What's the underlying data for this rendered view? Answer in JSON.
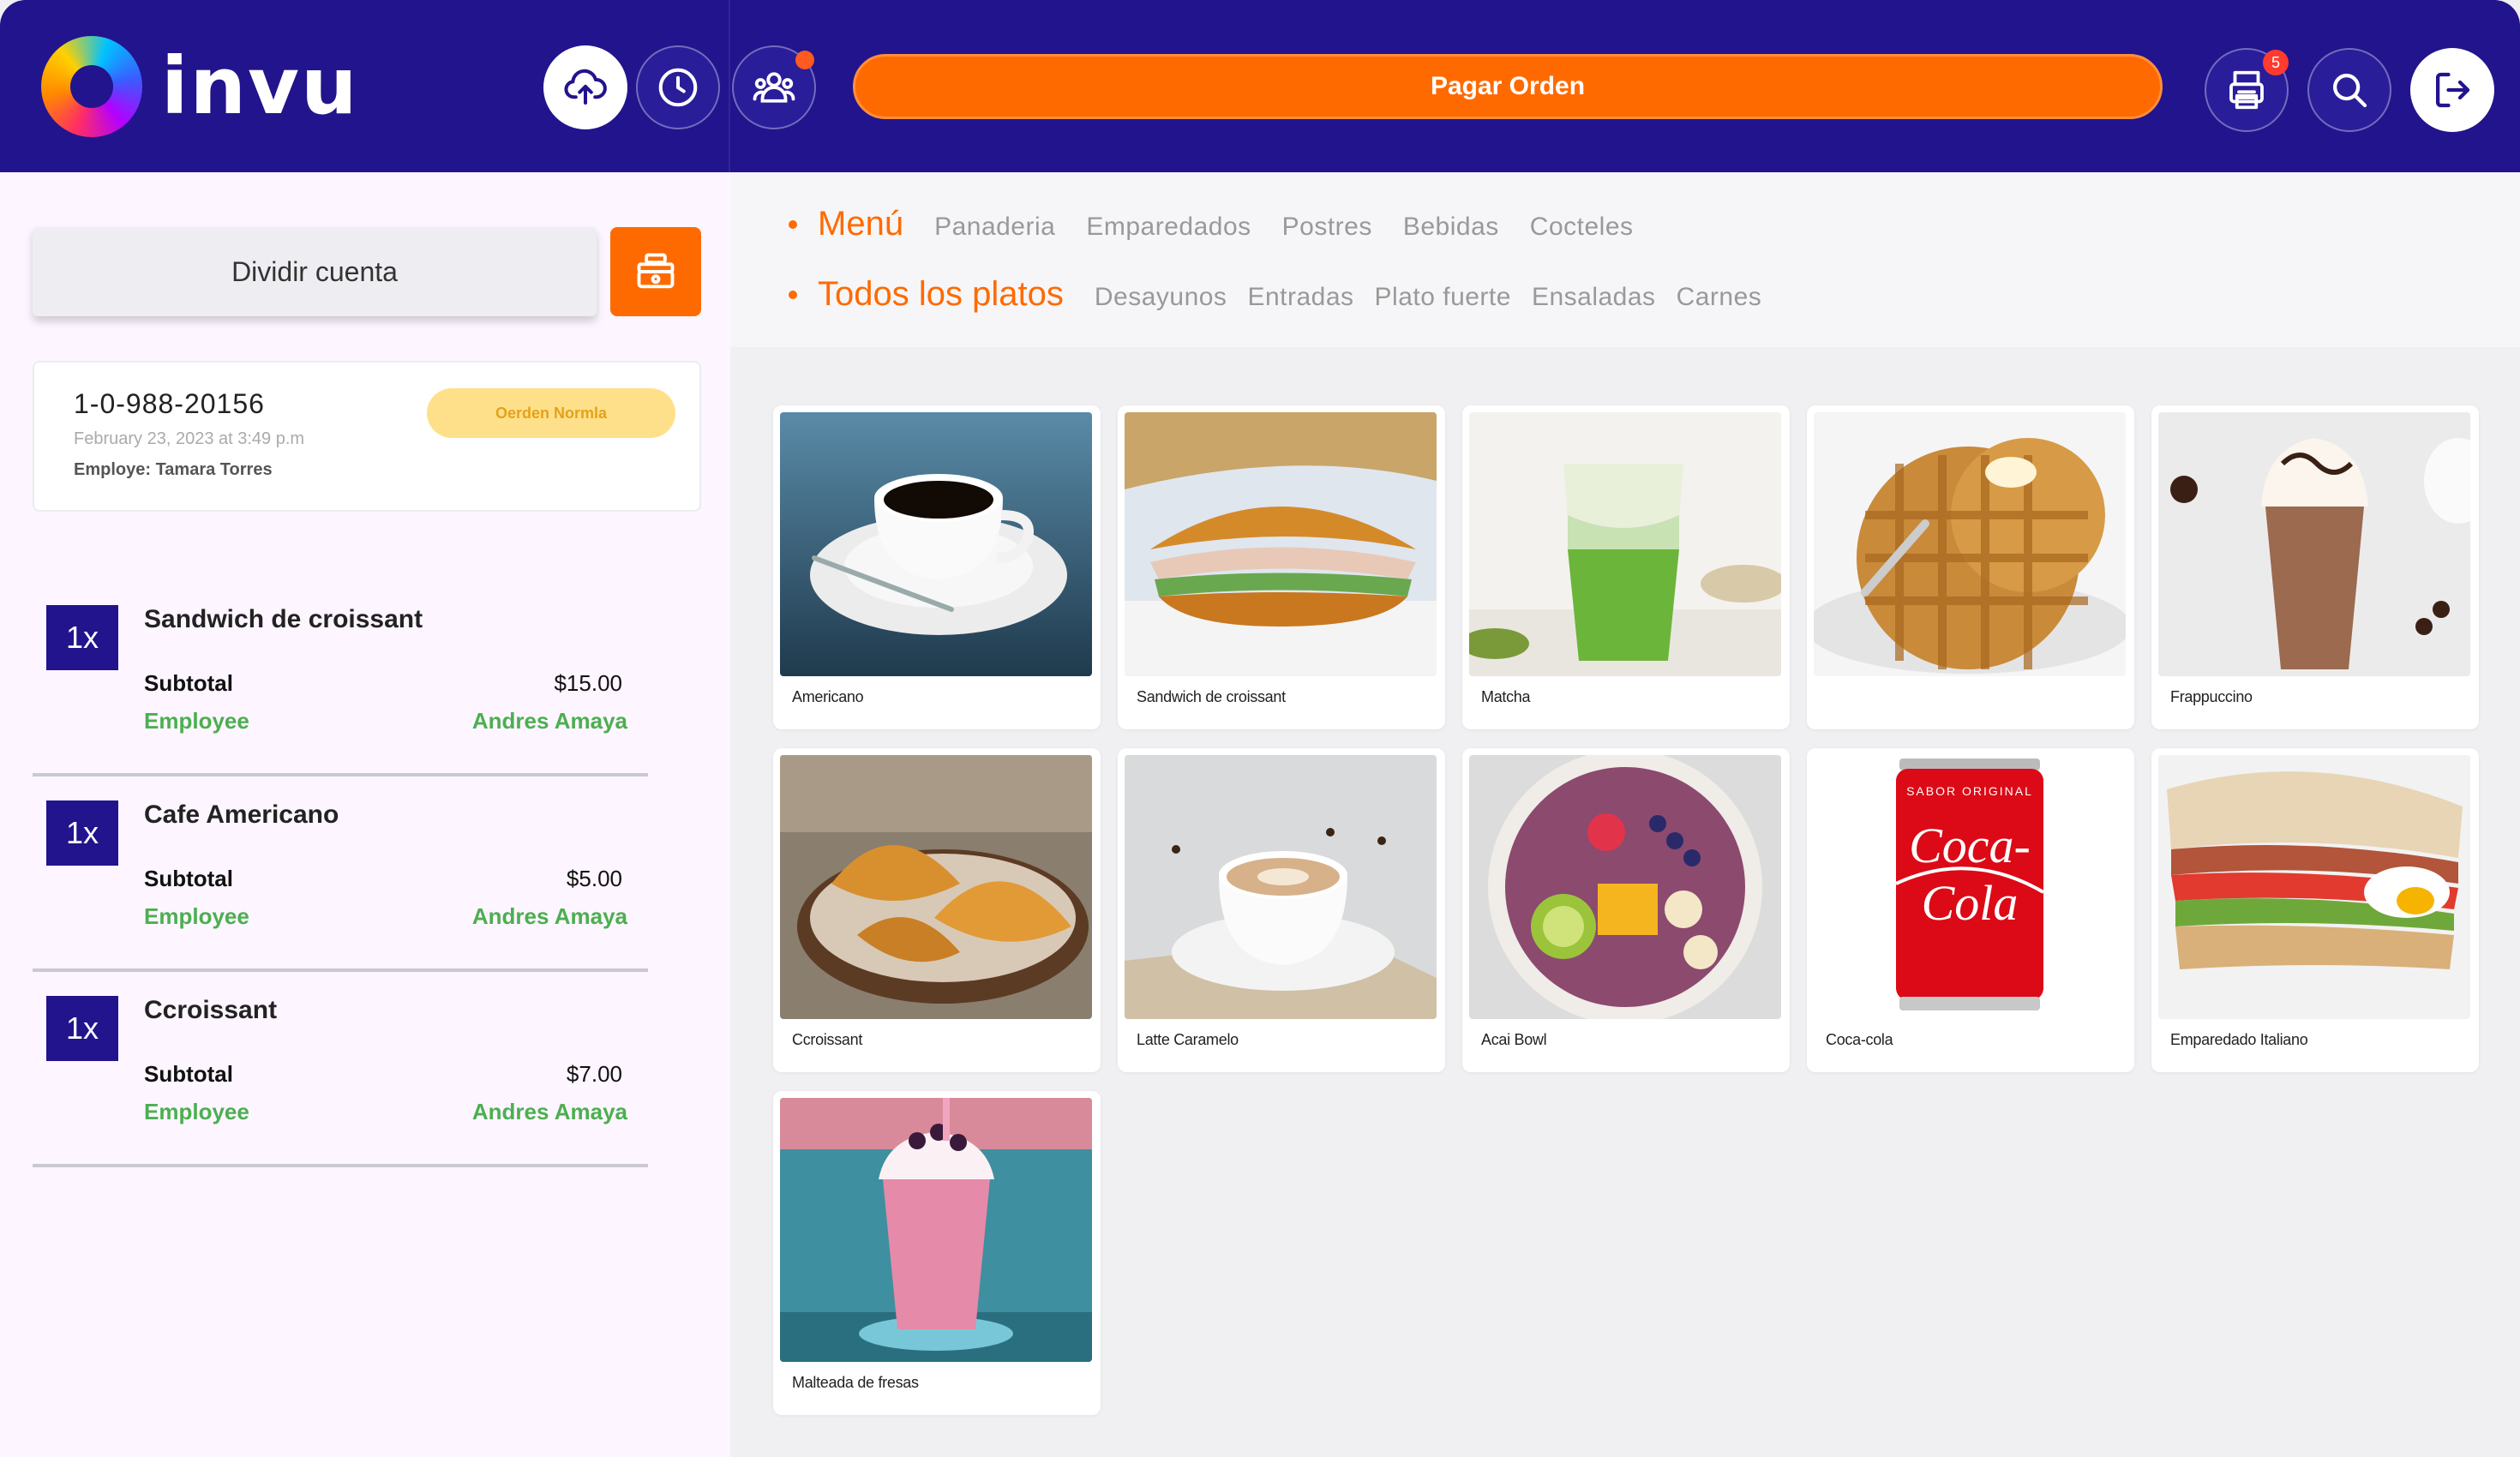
{
  "header": {
    "logo_text": "invu",
    "pay_button_label": "Pagar Orden",
    "notification_badge": "5",
    "icons": [
      "cloud-upload-icon",
      "clock-icon",
      "users-icon",
      "printer-icon",
      "search-icon",
      "logout-icon"
    ]
  },
  "left_panel": {
    "split_button_label": "Dividir cuenta",
    "order": {
      "number": "1-0-988-20156",
      "date": "February 23, 2023 at 3:49 p.m",
      "employee": "Employe: Tamara Torres",
      "type": "Oerden Normla"
    },
    "items": [
      {
        "qty": "1x",
        "name": "Sandwich de croissant",
        "subtotal_label": "Subtotal",
        "subtotal": "$15.00",
        "employee_label": "Employee",
        "employee": "Andres Amaya"
      },
      {
        "qty": "1x",
        "name": "Cafe Americano",
        "subtotal_label": "Subtotal",
        "subtotal": "$5.00",
        "employee_label": "Employee",
        "employee": "Andres Amaya"
      },
      {
        "qty": "1x",
        "name": "Ccroissant",
        "subtotal_label": "Subtotal",
        "subtotal": "$7.00",
        "employee_label": "Employee",
        "employee": "Andres Amaya"
      }
    ]
  },
  "nav": {
    "row1": {
      "active": "Menú",
      "items": [
        "Panaderia",
        "Emparedados",
        "Postres",
        "Bebidas",
        "Cocteles"
      ]
    },
    "row2": {
      "active": "Todos los platos",
      "items": [
        "Desayunos",
        "Entradas",
        "Plato fuerte",
        "Ensaladas",
        "Carnes"
      ]
    }
  },
  "products": [
    {
      "label": "Americano",
      "icon": "coffee-cup-image"
    },
    {
      "label": "Sandwich de croissant",
      "icon": "croissant-sandwich-image"
    },
    {
      "label": "Matcha",
      "icon": "matcha-drink-image"
    },
    {
      "label": "",
      "icon": "waffle-image"
    },
    {
      "label": "Frappuccino",
      "icon": "frappuccino-image"
    },
    {
      "label": "Ccroissant",
      "icon": "croissant-image"
    },
    {
      "label": "Latte Caramelo",
      "icon": "latte-image"
    },
    {
      "label": "Acai Bowl",
      "icon": "acai-bowl-image"
    },
    {
      "label": "Coca-cola",
      "icon": "soda-can-image",
      "can_top_text": "SABOR ORIGINAL",
      "can_brand_text": "Coca-Cola"
    },
    {
      "label": "Emparedado Italiano",
      "icon": "italian-sandwich-image"
    },
    {
      "label": "Malteada de fresas",
      "icon": "strawberry-shake-image"
    }
  ],
  "colors": {
    "header_bg": "#22148c",
    "accent_orange": "#ff6a00",
    "employee_green": "#4caf50",
    "qty_badge_bg": "#22148c",
    "order_type_bg": "#ffe08a"
  }
}
